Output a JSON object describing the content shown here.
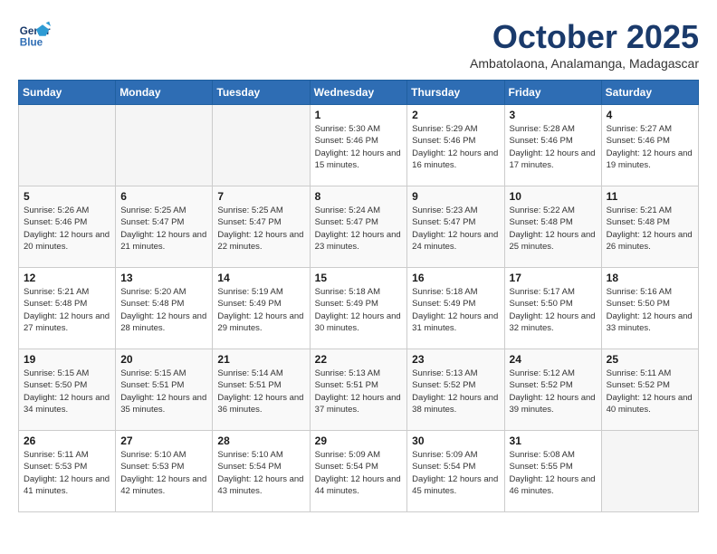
{
  "header": {
    "logo_line1": "General",
    "logo_line2": "Blue",
    "month": "October 2025",
    "location": "Ambatolaona, Analamanga, Madagascar"
  },
  "weekdays": [
    "Sunday",
    "Monday",
    "Tuesday",
    "Wednesday",
    "Thursday",
    "Friday",
    "Saturday"
  ],
  "weeks": [
    [
      {
        "day": "",
        "empty": true
      },
      {
        "day": "",
        "empty": true
      },
      {
        "day": "",
        "empty": true
      },
      {
        "day": "1",
        "sunrise": "5:30 AM",
        "sunset": "5:46 PM",
        "daylight": "12 hours and 15 minutes."
      },
      {
        "day": "2",
        "sunrise": "5:29 AM",
        "sunset": "5:46 PM",
        "daylight": "12 hours and 16 minutes."
      },
      {
        "day": "3",
        "sunrise": "5:28 AM",
        "sunset": "5:46 PM",
        "daylight": "12 hours and 17 minutes."
      },
      {
        "day": "4",
        "sunrise": "5:27 AM",
        "sunset": "5:46 PM",
        "daylight": "12 hours and 19 minutes."
      }
    ],
    [
      {
        "day": "5",
        "sunrise": "5:26 AM",
        "sunset": "5:46 PM",
        "daylight": "12 hours and 20 minutes."
      },
      {
        "day": "6",
        "sunrise": "5:25 AM",
        "sunset": "5:47 PM",
        "daylight": "12 hours and 21 minutes."
      },
      {
        "day": "7",
        "sunrise": "5:25 AM",
        "sunset": "5:47 PM",
        "daylight": "12 hours and 22 minutes."
      },
      {
        "day": "8",
        "sunrise": "5:24 AM",
        "sunset": "5:47 PM",
        "daylight": "12 hours and 23 minutes."
      },
      {
        "day": "9",
        "sunrise": "5:23 AM",
        "sunset": "5:47 PM",
        "daylight": "12 hours and 24 minutes."
      },
      {
        "day": "10",
        "sunrise": "5:22 AM",
        "sunset": "5:48 PM",
        "daylight": "12 hours and 25 minutes."
      },
      {
        "day": "11",
        "sunrise": "5:21 AM",
        "sunset": "5:48 PM",
        "daylight": "12 hours and 26 minutes."
      }
    ],
    [
      {
        "day": "12",
        "sunrise": "5:21 AM",
        "sunset": "5:48 PM",
        "daylight": "12 hours and 27 minutes."
      },
      {
        "day": "13",
        "sunrise": "5:20 AM",
        "sunset": "5:48 PM",
        "daylight": "12 hours and 28 minutes."
      },
      {
        "day": "14",
        "sunrise": "5:19 AM",
        "sunset": "5:49 PM",
        "daylight": "12 hours and 29 minutes."
      },
      {
        "day": "15",
        "sunrise": "5:18 AM",
        "sunset": "5:49 PM",
        "daylight": "12 hours and 30 minutes."
      },
      {
        "day": "16",
        "sunrise": "5:18 AM",
        "sunset": "5:49 PM",
        "daylight": "12 hours and 31 minutes."
      },
      {
        "day": "17",
        "sunrise": "5:17 AM",
        "sunset": "5:50 PM",
        "daylight": "12 hours and 32 minutes."
      },
      {
        "day": "18",
        "sunrise": "5:16 AM",
        "sunset": "5:50 PM",
        "daylight": "12 hours and 33 minutes."
      }
    ],
    [
      {
        "day": "19",
        "sunrise": "5:15 AM",
        "sunset": "5:50 PM",
        "daylight": "12 hours and 34 minutes."
      },
      {
        "day": "20",
        "sunrise": "5:15 AM",
        "sunset": "5:51 PM",
        "daylight": "12 hours and 35 minutes."
      },
      {
        "day": "21",
        "sunrise": "5:14 AM",
        "sunset": "5:51 PM",
        "daylight": "12 hours and 36 minutes."
      },
      {
        "day": "22",
        "sunrise": "5:13 AM",
        "sunset": "5:51 PM",
        "daylight": "12 hours and 37 minutes."
      },
      {
        "day": "23",
        "sunrise": "5:13 AM",
        "sunset": "5:52 PM",
        "daylight": "12 hours and 38 minutes."
      },
      {
        "day": "24",
        "sunrise": "5:12 AM",
        "sunset": "5:52 PM",
        "daylight": "12 hours and 39 minutes."
      },
      {
        "day": "25",
        "sunrise": "5:11 AM",
        "sunset": "5:52 PM",
        "daylight": "12 hours and 40 minutes."
      }
    ],
    [
      {
        "day": "26",
        "sunrise": "5:11 AM",
        "sunset": "5:53 PM",
        "daylight": "12 hours and 41 minutes."
      },
      {
        "day": "27",
        "sunrise": "5:10 AM",
        "sunset": "5:53 PM",
        "daylight": "12 hours and 42 minutes."
      },
      {
        "day": "28",
        "sunrise": "5:10 AM",
        "sunset": "5:54 PM",
        "daylight": "12 hours and 43 minutes."
      },
      {
        "day": "29",
        "sunrise": "5:09 AM",
        "sunset": "5:54 PM",
        "daylight": "12 hours and 44 minutes."
      },
      {
        "day": "30",
        "sunrise": "5:09 AM",
        "sunset": "5:54 PM",
        "daylight": "12 hours and 45 minutes."
      },
      {
        "day": "31",
        "sunrise": "5:08 AM",
        "sunset": "5:55 PM",
        "daylight": "12 hours and 46 minutes."
      },
      {
        "day": "",
        "empty": true
      }
    ]
  ],
  "labels": {
    "sunrise_prefix": "Sunrise:",
    "sunset_prefix": "Sunset:",
    "daylight_prefix": "Daylight:"
  }
}
